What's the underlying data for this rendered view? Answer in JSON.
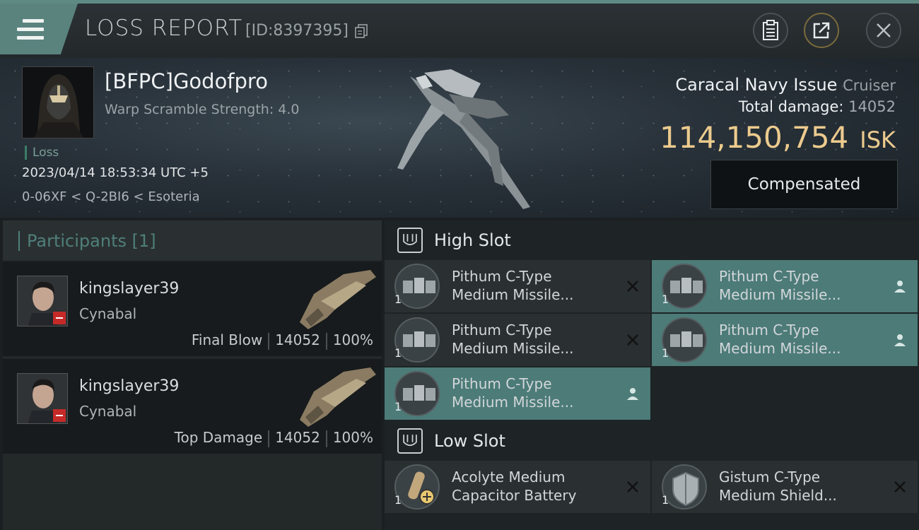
{
  "header": {
    "title": "LOSS REPORT",
    "report_id": "[ID:8397395]",
    "buttons": [
      "clipboard",
      "share",
      "close"
    ]
  },
  "victim": {
    "pilot_name": "[BFPC]Godofpro",
    "warp_scramble": "Warp Scramble Strength: 4.0",
    "status": "Loss",
    "datetime": "2023/04/14 18:53:34 UTC +5",
    "location": "0-06XF < Q-2BI6 < Esoteria",
    "ship_name": "Caracal Navy Issue",
    "ship_class": "Cruiser",
    "total_damage_label": "Total damage:",
    "total_damage_value": "14052",
    "isk_value": "114,150,754",
    "isk_unit": "ISK",
    "compensated_label": "Compensated"
  },
  "participants": {
    "title": "Participants [1]",
    "items": [
      {
        "name": "kingslayer39",
        "ship": "Cynabal",
        "role": "Final Blow",
        "damage": "14052",
        "percent": "100%"
      },
      {
        "name": "kingslayer39",
        "ship": "Cynabal",
        "role": "Top Damage",
        "damage": "14052",
        "percent": "100%"
      }
    ]
  },
  "fitting": {
    "high_slot": {
      "label": "High Slot",
      "modules": [
        {
          "line1": "Pithum C-Type",
          "line2": "Medium Missile...",
          "qty": "1",
          "action": "destroyed"
        },
        {
          "line1": "Pithum C-Type",
          "line2": "Medium Missile...",
          "qty": "1",
          "action": "dropped"
        },
        {
          "line1": "Pithum C-Type",
          "line2": "Medium Missile...",
          "qty": "1",
          "action": "destroyed"
        },
        {
          "line1": "Pithum C-Type",
          "line2": "Medium Missile...",
          "qty": "1",
          "action": "dropped"
        },
        {
          "line1": "Pithum C-Type",
          "line2": "Medium Missile...",
          "qty": "1",
          "action": "dropped"
        }
      ]
    },
    "low_slot": {
      "label": "Low Slot",
      "modules": [
        {
          "line1": "Acolyte Medium",
          "line2": "Capacitor Battery",
          "qty": "1",
          "action": "destroyed"
        },
        {
          "line1": "Gistum C-Type",
          "line2": "Medium Shield...",
          "qty": "1",
          "action": "destroyed"
        }
      ]
    }
  },
  "colors": {
    "accent": "#5a837e",
    "isk": "#eccb8e",
    "active_module": "#4c7b78",
    "loss_badge": "#c52a28"
  }
}
